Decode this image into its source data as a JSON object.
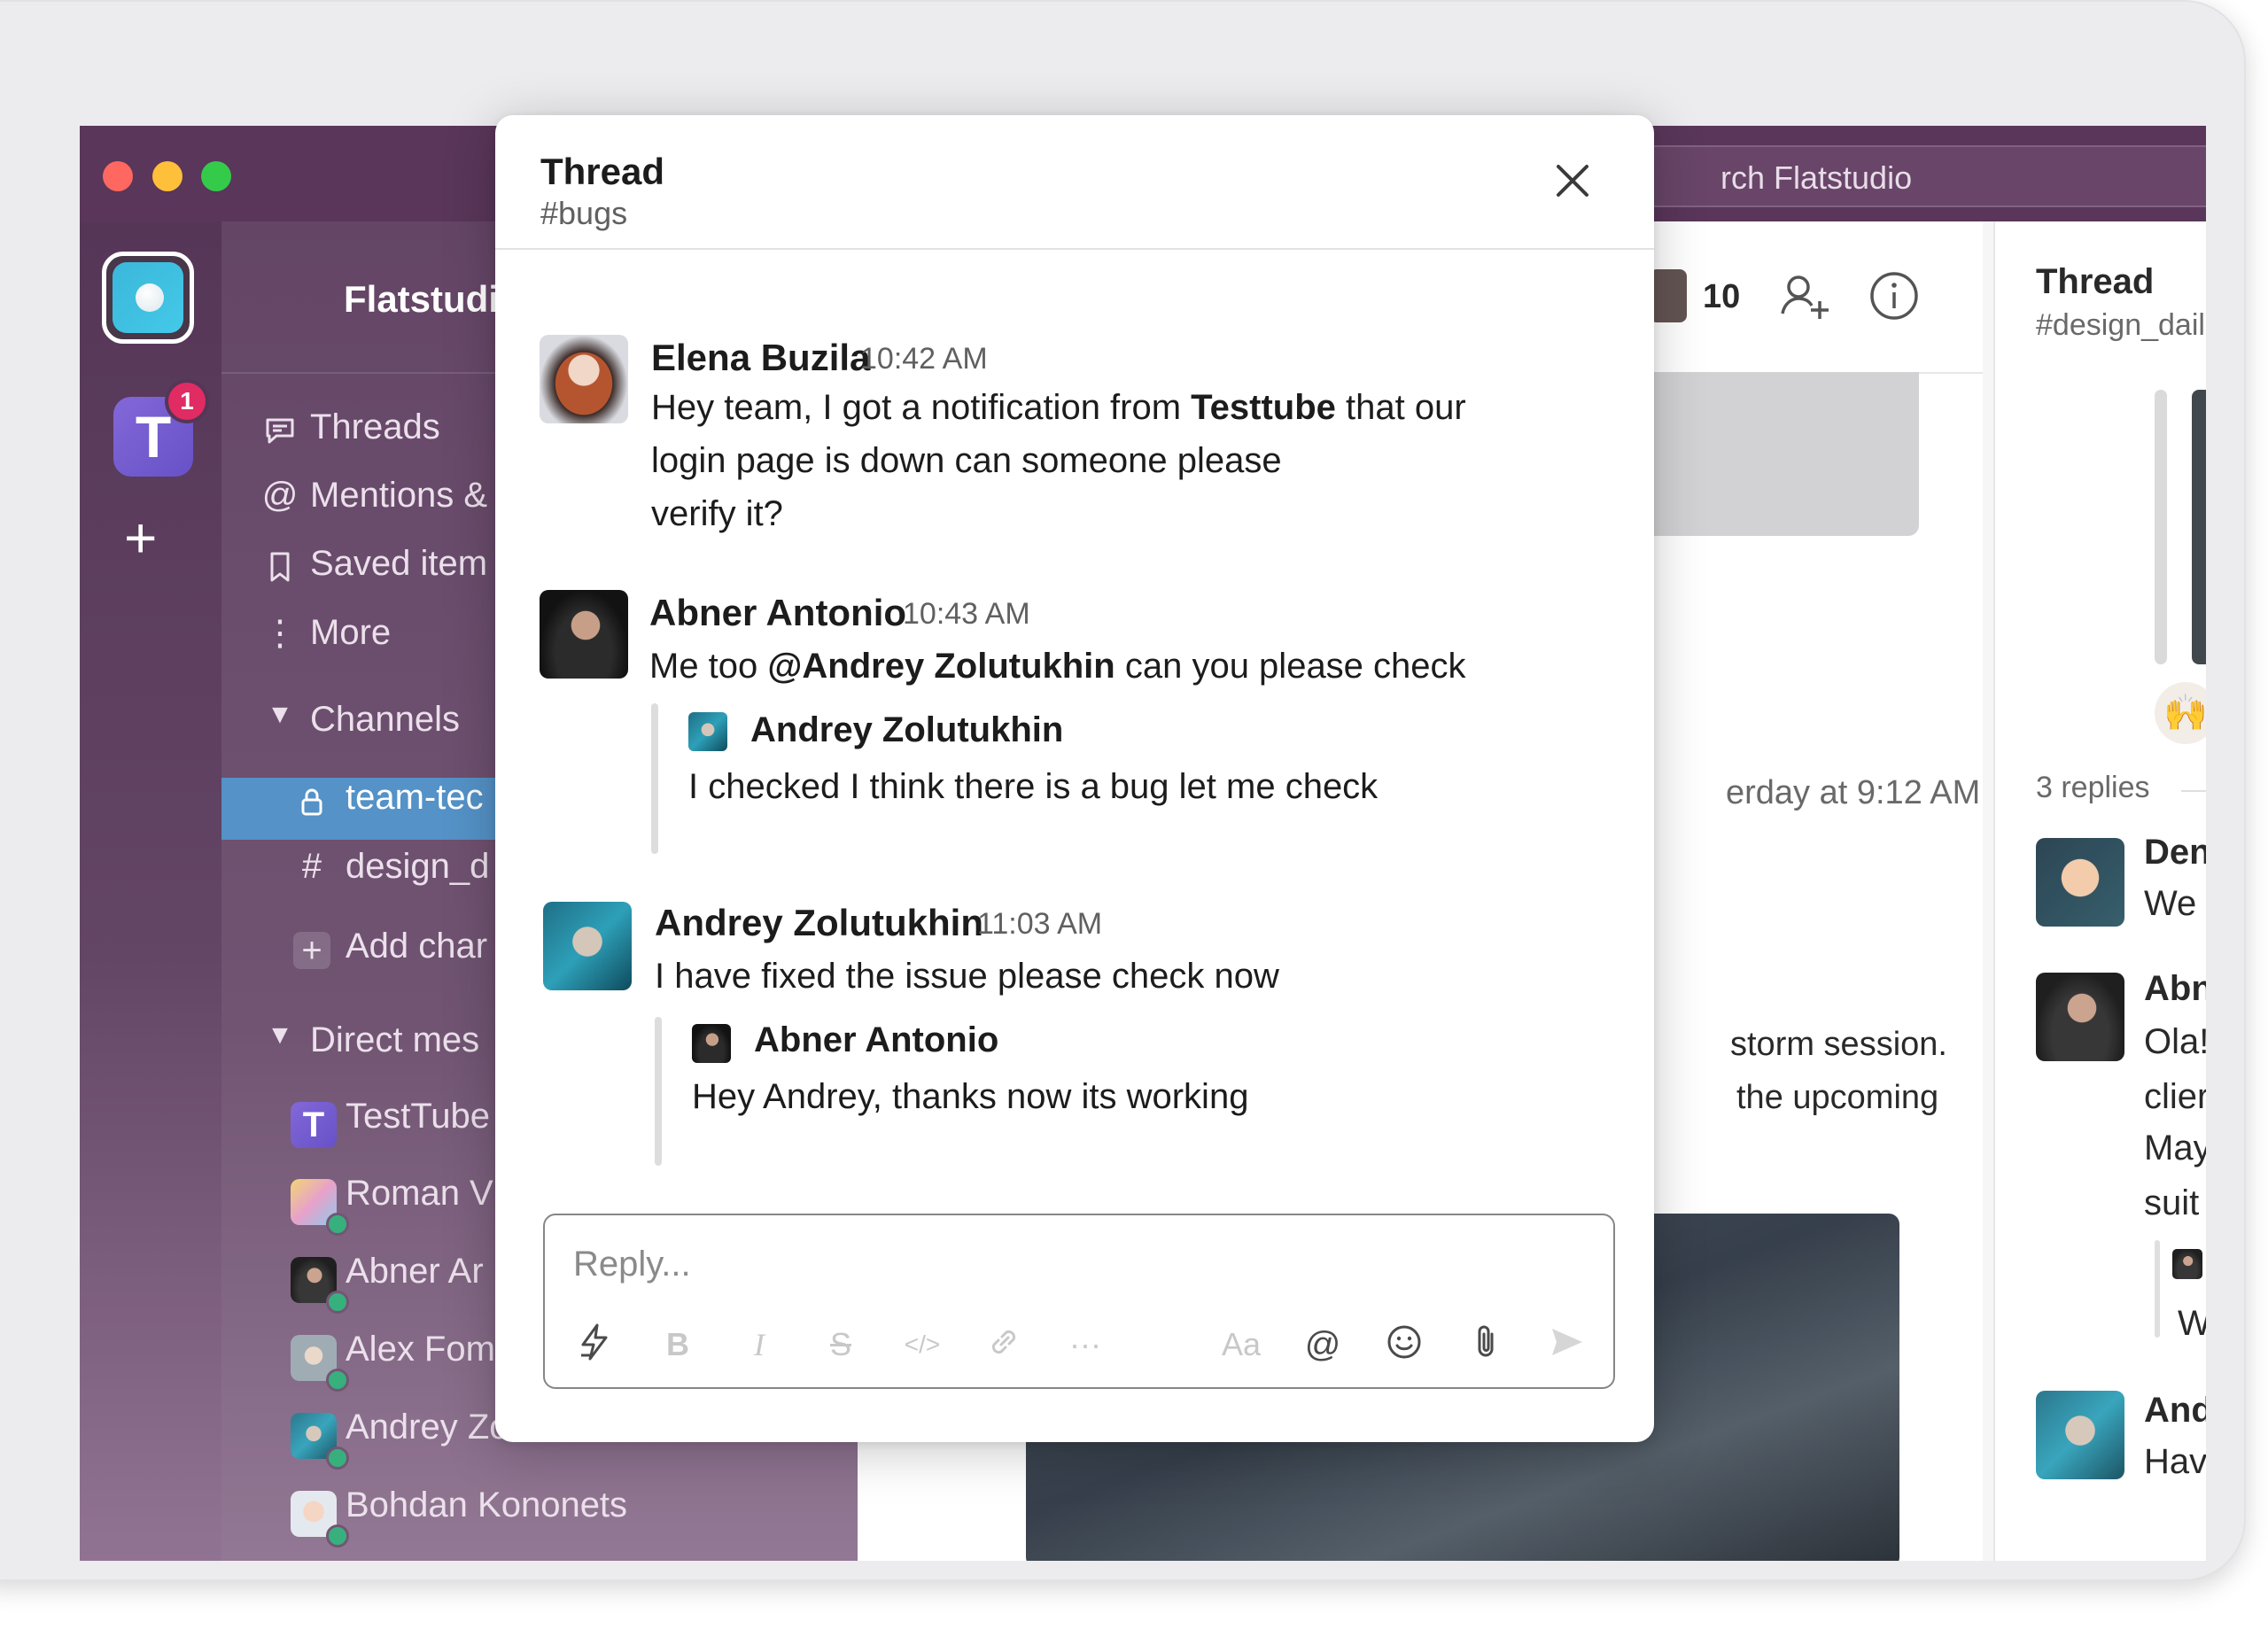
{
  "window": {
    "search_placeholder": "Search Flatstudio",
    "search_visible": "rch Flatstudio"
  },
  "rail": {
    "badge_count": "1",
    "testtube_letter": "T",
    "add_label": "+"
  },
  "sidebar": {
    "workspace_name": "Flatstudio",
    "items": [
      {
        "icon": "threads-icon",
        "label": "Threads"
      },
      {
        "icon": "at-icon",
        "label": "Mentions &"
      },
      {
        "icon": "bookmark-icon",
        "label": "Saved item"
      },
      {
        "icon": "more-vertical-icon",
        "label": "More"
      }
    ],
    "channels_header": "Channels",
    "channels": [
      {
        "prefix": "🔒",
        "label": "team-tec",
        "active": true
      },
      {
        "prefix": "#",
        "label": "design_d",
        "active": false
      }
    ],
    "add_channel": "Add char",
    "dm_header": "Direct mes",
    "dms": [
      {
        "name": "TestTube"
      },
      {
        "name": "Roman V"
      },
      {
        "name": "Abner Ar"
      },
      {
        "name": "Alex Fom"
      },
      {
        "name": "Andrey Zolotukhin"
      },
      {
        "name": "Bohdan Kononets"
      }
    ]
  },
  "main": {
    "member_count": "10",
    "timestamp_fragment": "erday at 9:12 AM",
    "text_line_1": "storm session.",
    "text_line_2": "the upcoming"
  },
  "right_panel": {
    "title": "Thread",
    "subtitle": "#design_dail",
    "replies": "3 replies",
    "entries": [
      {
        "name": "Den",
        "text": "We"
      },
      {
        "name": "Abn",
        "lines": [
          "Ola!",
          "clier",
          "May",
          "suit"
        ]
      },
      {
        "name": "And",
        "text": "Hav"
      }
    ],
    "quote_text": "W"
  },
  "thread": {
    "title": "Thread",
    "channel": "#bugs",
    "messages": [
      {
        "author": "Elena Buzila",
        "time": "10:42 AM",
        "text_parts": [
          "Hey team, I got a notification from ",
          "Testtube",
          " that our",
          "login page is down can someone please",
          "verify it?"
        ]
      },
      {
        "author": "Abner Antonio",
        "time": "10:43 AM",
        "text_parts": [
          "Me too ",
          "@Andrey Zolutukhin",
          " can you please check"
        ],
        "quote": {
          "author": "Andrey Zolutukhin",
          "text": "I checked I think there is a bug let me check"
        }
      },
      {
        "author": "Andrey Zolutukhin",
        "time": "11:03 AM",
        "text": "I have fixed the issue please check now",
        "quote": {
          "author": "Abner Antonio",
          "text": "Hey Andrey, thanks now its working"
        }
      }
    ],
    "composer": {
      "placeholder": "Reply...",
      "tools": [
        "shortcut-icon",
        "bold-icon",
        "italic-icon",
        "strikethrough-icon",
        "code-icon",
        "link-icon",
        "more-horizontal-icon",
        "text-format-icon",
        "mention-icon",
        "emoji-icon",
        "attachment-icon",
        "send-icon"
      ],
      "labels": {
        "bold": "B",
        "italic": "I",
        "strike": "S",
        "code": "</>",
        "more": "···",
        "format": "Aa",
        "mention": "@"
      }
    }
  },
  "colors": {
    "titlebar": "#4f2a50",
    "sidebar": "#5b3a5d",
    "active_channel": "#4a8cc4",
    "badge": "#e01e5a",
    "presence": "#2bac76"
  }
}
